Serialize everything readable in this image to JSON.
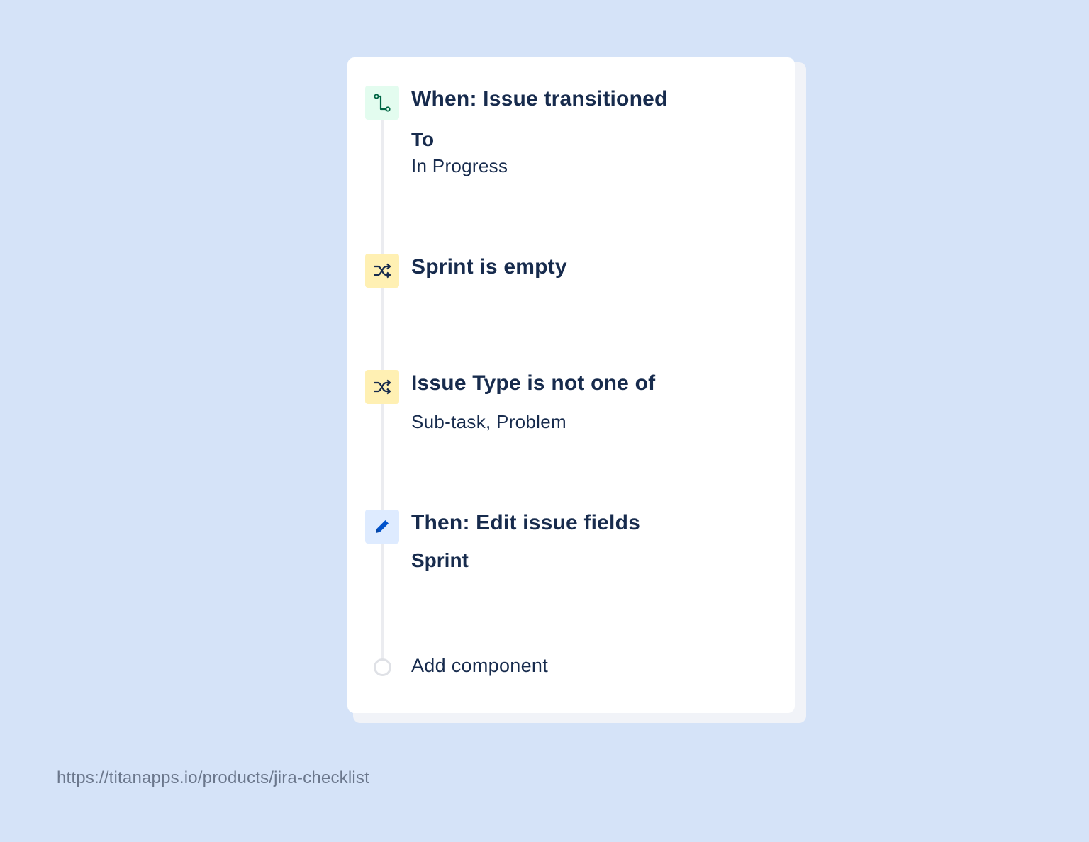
{
  "rule": {
    "trigger": {
      "icon": "transition-icon",
      "title": "When: Issue transitioned",
      "label": "To",
      "value": "In Progress"
    },
    "conditions": [
      {
        "icon": "shuffle-icon",
        "title": "Sprint is empty"
      },
      {
        "icon": "shuffle-icon",
        "title": "Issue Type is not one of",
        "value": "Sub-task, Problem"
      }
    ],
    "action": {
      "icon": "pencil-icon",
      "title": "Then: Edit issue fields",
      "field": "Sprint"
    },
    "add_component": "Add component"
  },
  "footer": {
    "url": "https://titanapps.io/products/jira-checklist"
  },
  "colors": {
    "background": "#d5e3f8",
    "text": "#172b4d",
    "trigger_icon_bg": "#e3fcef",
    "condition_icon_bg": "#fff0b3",
    "action_icon_bg": "#deebff"
  }
}
